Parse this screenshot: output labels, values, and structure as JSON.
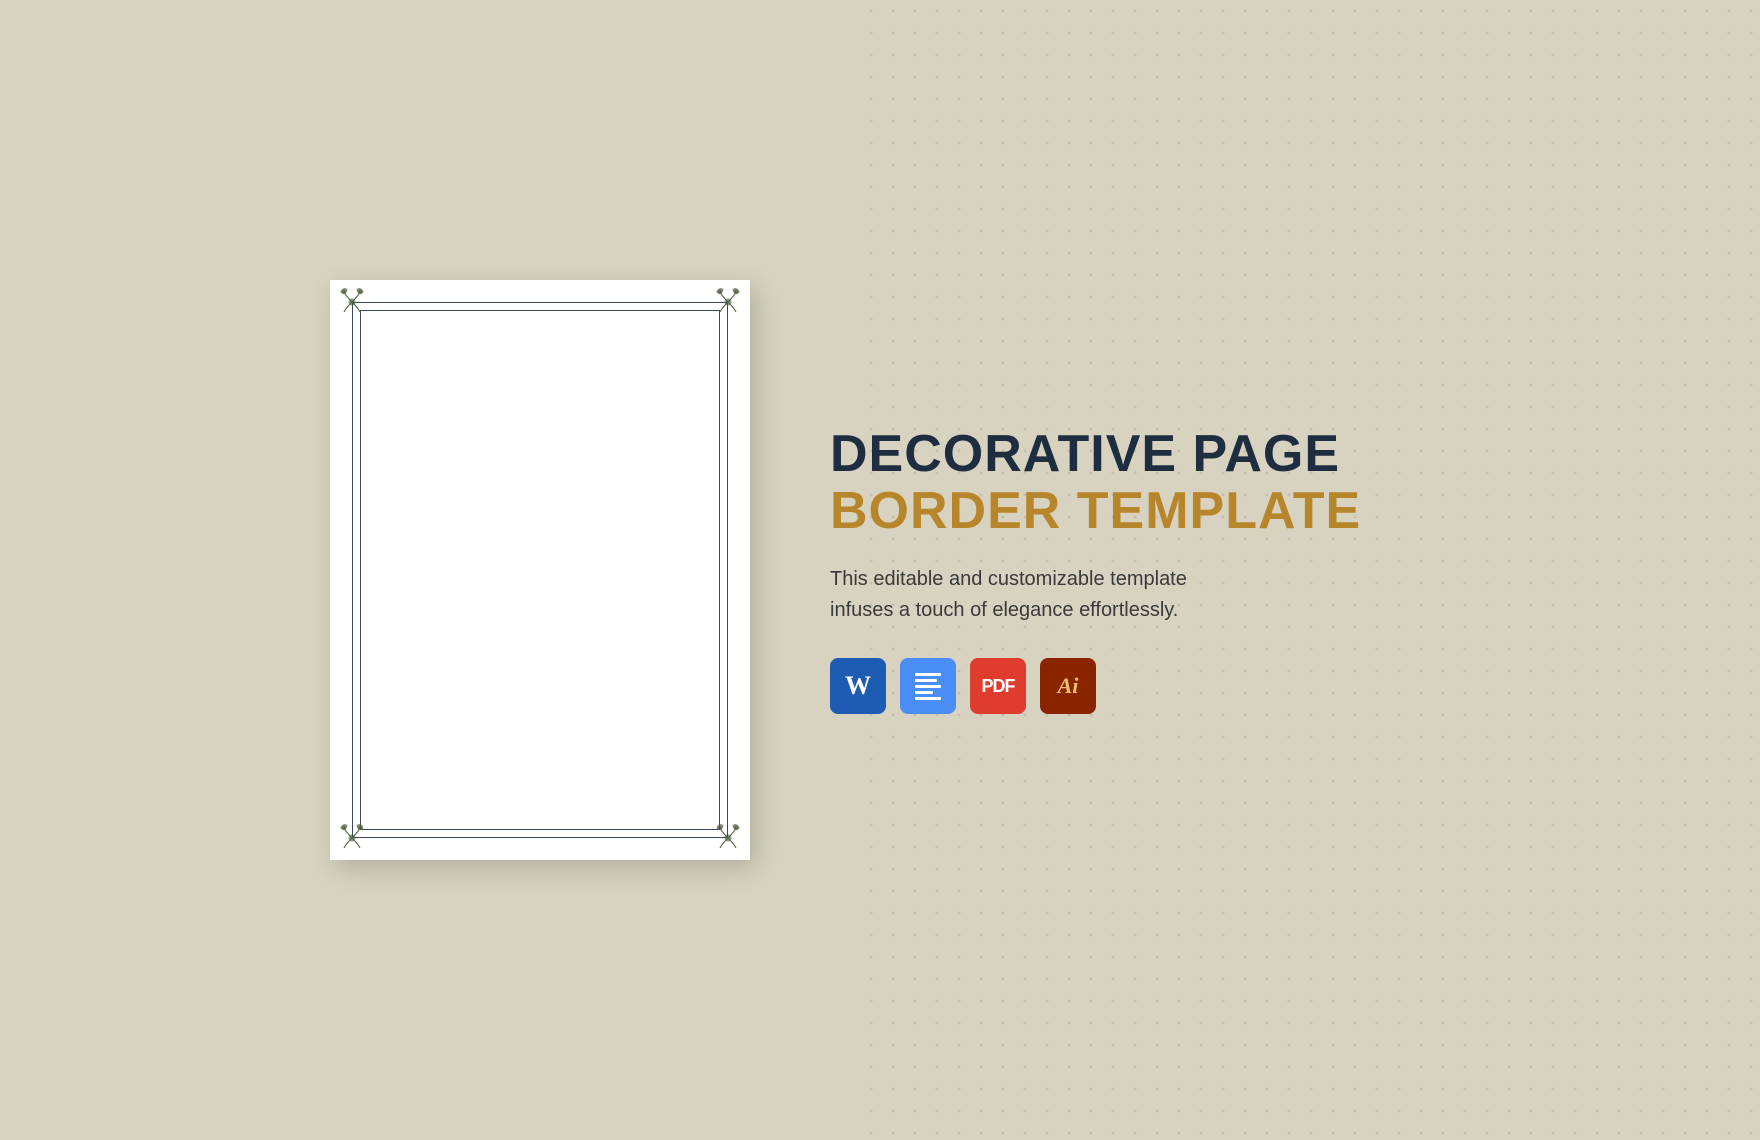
{
  "background": {
    "color": "#d8d3c0"
  },
  "title": {
    "line1": "DECORATIVE PAGE",
    "line2": "BORDER TEMPLATE"
  },
  "description": "This editable and customizable template infuses a touch of elegance effortlessly.",
  "app_icons": [
    {
      "name": "Microsoft Word",
      "type": "word",
      "label": "W"
    },
    {
      "name": "Google Docs",
      "type": "docs",
      "label": "≡"
    },
    {
      "name": "Adobe Acrobat PDF",
      "type": "pdf",
      "label": "PDF"
    },
    {
      "name": "Adobe Illustrator",
      "type": "ai",
      "label": "Ai"
    }
  ],
  "document": {
    "alt": "Decorative page border template preview"
  }
}
